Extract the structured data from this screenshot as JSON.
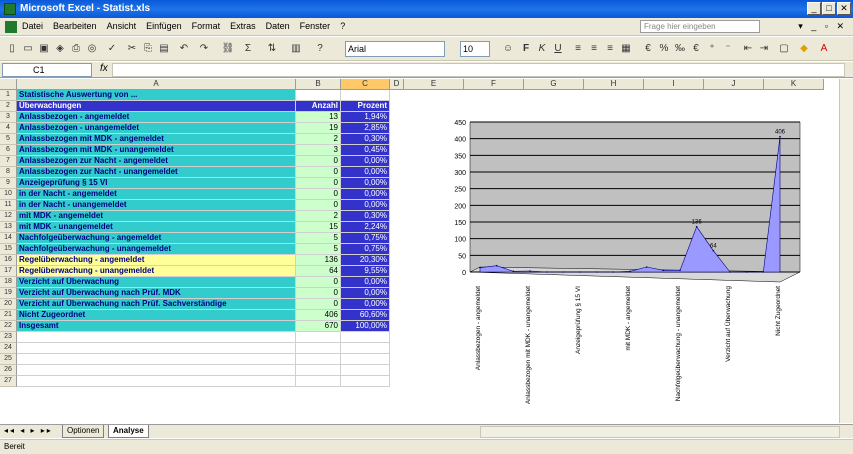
{
  "window": {
    "title": "Microsoft Excel - Statist.xls"
  },
  "menu": [
    "Datei",
    "Bearbeiten",
    "Ansicht",
    "Einfügen",
    "Format",
    "Extras",
    "Daten",
    "Fenster",
    "?"
  ],
  "help_placeholder": "Frage hier eingeben",
  "toolbar": {
    "font": "Arial",
    "size": "10"
  },
  "formula": {
    "cell": "C1",
    "fx": "fx",
    "content": ""
  },
  "columns": [
    "A",
    "B",
    "C",
    "D",
    "E",
    "F",
    "G",
    "H",
    "I",
    "J",
    "K"
  ],
  "table": {
    "title": "Statistische Auswertung von ...",
    "header": {
      "a": "Überwachungen",
      "b": "Anzahl",
      "c": "Prozent"
    },
    "rows": [
      {
        "n": "3",
        "label": "Anlassbezogen - angemeldet",
        "count": "13",
        "pct": "1,94%"
      },
      {
        "n": "4",
        "label": "Anlassbezogen - unangemeldet",
        "count": "19",
        "pct": "2,85%"
      },
      {
        "n": "5",
        "label": "Anlassbezogen mit MDK - angemeldet",
        "count": "2",
        "pct": "0,30%"
      },
      {
        "n": "6",
        "label": "Anlassbezogen mit MDK - unangemeldet",
        "count": "3",
        "pct": "0,45%"
      },
      {
        "n": "7",
        "label": "Anlassbezogen zur Nacht - angemeldet",
        "count": "0",
        "pct": "0,00%"
      },
      {
        "n": "8",
        "label": "Anlassbezogen zur Nacht - unangemeldet",
        "count": "0",
        "pct": "0,00%"
      },
      {
        "n": "9",
        "label": "Anzeigeprüfung § 15 VI",
        "count": "0",
        "pct": "0,00%"
      },
      {
        "n": "10",
        "label": "in der Nacht - angemeldet",
        "count": "0",
        "pct": "0,00%"
      },
      {
        "n": "11",
        "label": "in der Nacht - unangemeldet",
        "count": "0",
        "pct": "0,00%"
      },
      {
        "n": "12",
        "label": "mit MDK - angemeldet",
        "count": "2",
        "pct": "0,30%"
      },
      {
        "n": "13",
        "label": "mit MDK - unangemeldet",
        "count": "15",
        "pct": "2,24%"
      },
      {
        "n": "14",
        "label": "Nachfolgeüberwachung - angemeldet",
        "count": "5",
        "pct": "0,75%"
      },
      {
        "n": "15",
        "label": "Nachfolgeüberwachung - unangemeldet",
        "count": "5",
        "pct": "0,75%"
      },
      {
        "n": "16",
        "label": "Regelüberwachung - angemeldet",
        "count": "136",
        "pct": "20,30%"
      },
      {
        "n": "17",
        "label": "Regelüberwachung - unangemeldet",
        "count": "64",
        "pct": "9,55%"
      },
      {
        "n": "18",
        "label": "Verzicht auf Überwachung",
        "count": "0",
        "pct": "0,00%"
      },
      {
        "n": "19",
        "label": "Verzicht auf Überwachung nach Prüf. MDK",
        "count": "0",
        "pct": "0,00%"
      },
      {
        "n": "20",
        "label": "Verzicht auf Überwachung nach Prüf. Sachverständige",
        "count": "0",
        "pct": "0,00%"
      },
      {
        "n": "21",
        "label": "Nicht Zugeordnet",
        "count": "406",
        "pct": "60,60%"
      }
    ],
    "total": {
      "n": "22",
      "label": "Insgesamt",
      "count": "670",
      "pct": "100,00%"
    }
  },
  "empty_rows": [
    "23",
    "24",
    "25",
    "26",
    "27"
  ],
  "chart_data": {
    "type": "area",
    "title": "",
    "xlabel": "",
    "ylabel": "",
    "ylim": [
      0,
      450
    ],
    "yticks": [
      0,
      50,
      100,
      150,
      200,
      250,
      300,
      350,
      400,
      450
    ],
    "tick_labels": [
      "Anlassbezogen - angemeldet",
      "Anlassbezogen mit MDK - unangemeldet",
      "Anzeigeprüfung § 15 VI",
      "mit MDK - angemeldet",
      "Nachfolgeüberwachung - unangemeldet",
      "Verzicht auf Überwachung",
      "Nicht Zugeordnet"
    ],
    "categories": [
      "Anlassbezogen - angemeldet",
      "Anlassbezogen - unangemeldet",
      "Anlassbezogen mit MDK - angemeldet",
      "Anlassbezogen mit MDK - unangemeldet",
      "Anlassbezogen zur Nacht - angemeldet",
      "Anlassbezogen zur Nacht - unangemeldet",
      "Anzeigeprüfung § 15 VI",
      "in der Nacht - angemeldet",
      "in der Nacht - unangemeldet",
      "mit MDK - angemeldet",
      "mit MDK - unangemeldet",
      "Nachfolgeüberwachung - angemeldet",
      "Nachfolgeüberwachung - unangemeldet",
      "Regelüberwachung - angemeldet",
      "Regelüberwachung - unangemeldet",
      "Verzicht auf Überwachung",
      "Verzicht auf Überwachung nach Prüf. MDK",
      "Verzicht auf Überwachung nach Prüf. Sachverständige",
      "Nicht Zugeordnet"
    ],
    "values": [
      13,
      19,
      2,
      3,
      0,
      0,
      0,
      0,
      0,
      2,
      15,
      5,
      5,
      136,
      64,
      0,
      0,
      0,
      406
    ],
    "data_labels": [
      {
        "index": 13,
        "text": "136"
      },
      {
        "index": 14,
        "text": "64"
      },
      {
        "index": 18,
        "text": "406"
      }
    ],
    "colors": {
      "series": "#9999ff",
      "wall": "#c0c0c0",
      "series_edge": "#000080"
    }
  },
  "sheet_tabs": [
    {
      "label": "Optionen",
      "active": false
    },
    {
      "label": "Analyse",
      "active": true
    }
  ],
  "status": "Bereit"
}
